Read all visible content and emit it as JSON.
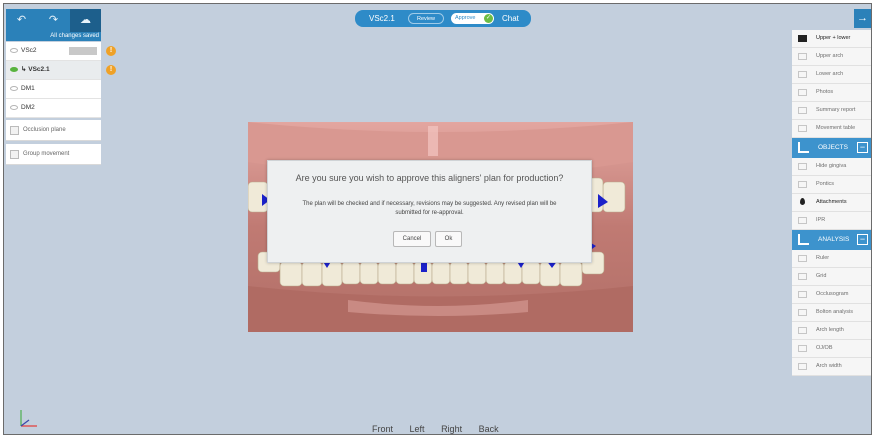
{
  "toolbar": {
    "undo_icon": "↶",
    "redo_icon": "↷",
    "cloud_icon": "☁",
    "status": "All changes saved"
  },
  "versions": [
    {
      "label": "VSc2",
      "tag": "",
      "warn": "!"
    },
    {
      "label": "VSc2.1",
      "warn": "!"
    },
    {
      "label": "DM1"
    },
    {
      "label": "DM2"
    }
  ],
  "left_buttons": {
    "occlusion": "Occlusion plane",
    "group": "Group movement"
  },
  "status_pill": {
    "version": "VSc2.1",
    "review": "Review",
    "approve": "Approve",
    "check_icon": "✓",
    "chat": "Chat"
  },
  "collapse_icon": "→",
  "right_panel": {
    "top_items": [
      "Upper + lower",
      "Upper arch",
      "Lower arch",
      "Photos",
      "Summary report",
      "Movement table"
    ],
    "objects_header": "OBJECTS",
    "objects_items": [
      "Hide gingiva",
      "Pontics",
      "Attachments",
      "IPR"
    ],
    "analysis_header": "ANALYSIS",
    "analysis_items": [
      "Ruler",
      "Grid",
      "Occlusogram",
      "Bolton analysis",
      "Arch length",
      "OJ/OB",
      "Arch width"
    ],
    "minus": "−"
  },
  "dialog": {
    "title": "Are you sure you wish to approve this aligners' plan for production?",
    "message": "The plan will be checked and if necessary, revisions may be suggested. Any revised plan will be submitted for re-approval.",
    "cancel": "Cancel",
    "ok": "Ok"
  },
  "bottom_views": [
    "Front",
    "Left",
    "Right",
    "Back"
  ],
  "colors": {
    "accent": "#2b81b9",
    "viewport_bg": "#c3cfdd",
    "gum": "#c48b84",
    "attachment": "#1b21c9",
    "warning": "#efa126",
    "approved": "#6dbd45"
  }
}
